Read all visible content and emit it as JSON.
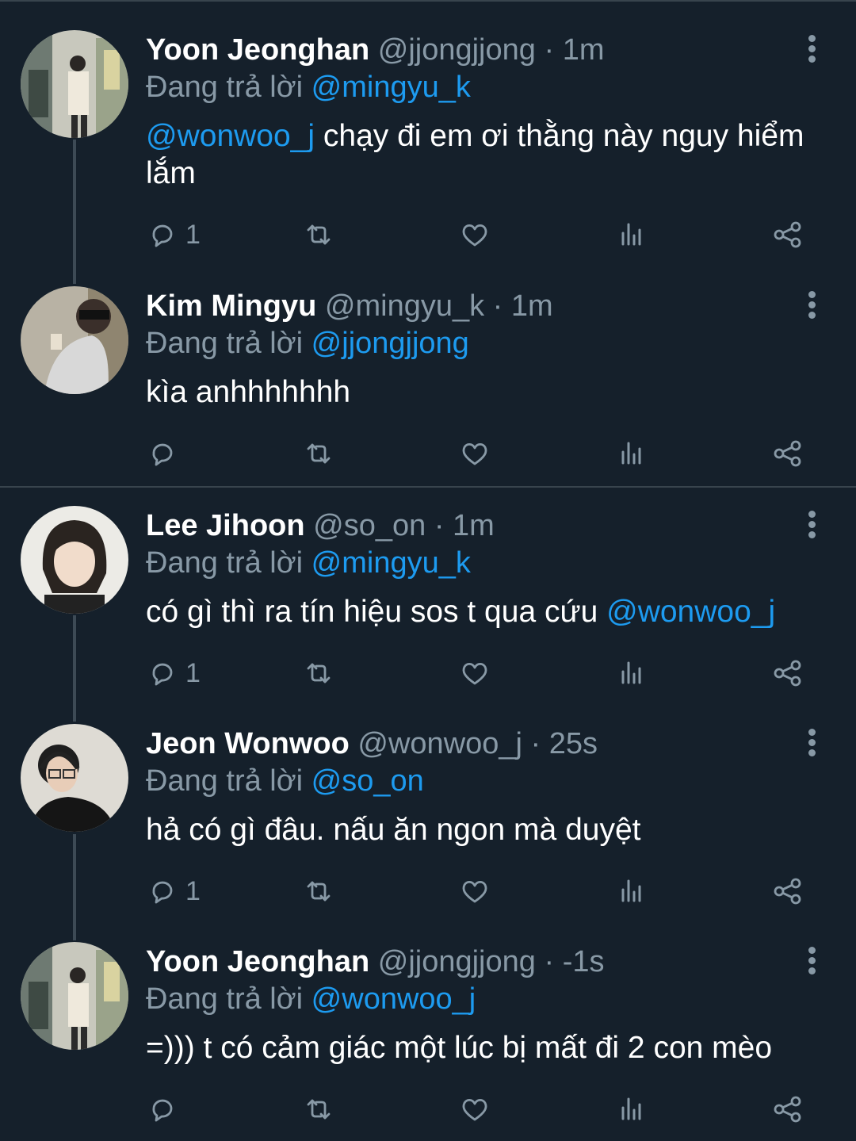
{
  "theme": {
    "background": "#15202b",
    "mention_color": "#1d9bf0",
    "muted_color": "#8899a6"
  },
  "icons": [
    "reply-icon",
    "retweet-icon",
    "like-icon",
    "views-icon",
    "share-icon",
    "more-icon"
  ],
  "tweets": [
    {
      "name": "Yoon Jeonghan",
      "handle": "@jjongjjong",
      "sep": " · ",
      "time": "1m",
      "replying_prefix": "Đang trả lời ",
      "replying_to": "@mingyu_k",
      "body_mention": "@wonwoo_j",
      "body_text": " chạy đi em ơi thằng này nguy hiểm lắm",
      "reply_count": "1"
    },
    {
      "name": "Kim Mingyu",
      "handle": "@mingyu_k",
      "sep": " · ",
      "time": "1m",
      "replying_prefix": "Đang trả lời ",
      "replying_to": "@jjongjjong",
      "body_text": "kìa anhhhhhhh",
      "reply_count": ""
    },
    {
      "name": "Lee Jihoon",
      "handle": "@so_on",
      "sep": " · ",
      "time": "1m",
      "replying_prefix": "Đang trả lời ",
      "replying_to": "@mingyu_k",
      "body_text": "có gì thì ra tín hiệu sos t qua cứu ",
      "body_mention": "@wonwoo_j",
      "reply_count": "1"
    },
    {
      "name": "Jeon Wonwoo",
      "handle": "@wonwoo_j",
      "sep": " · ",
      "time": "25s",
      "replying_prefix": "Đang trả lời ",
      "replying_to": "@so_on",
      "body_text": "hả có gì đâu. nấu ăn ngon mà duyệt",
      "reply_count": "1"
    },
    {
      "name": "Yoon Jeonghan",
      "handle": "@jjongjjong",
      "sep": " · ",
      "time": "-1s",
      "replying_prefix": "Đang trả lời ",
      "replying_to": "@wonwoo_j",
      "body_text": "=))) t có cảm giác một lúc bị mất đi 2 con mèo",
      "reply_count": ""
    }
  ]
}
